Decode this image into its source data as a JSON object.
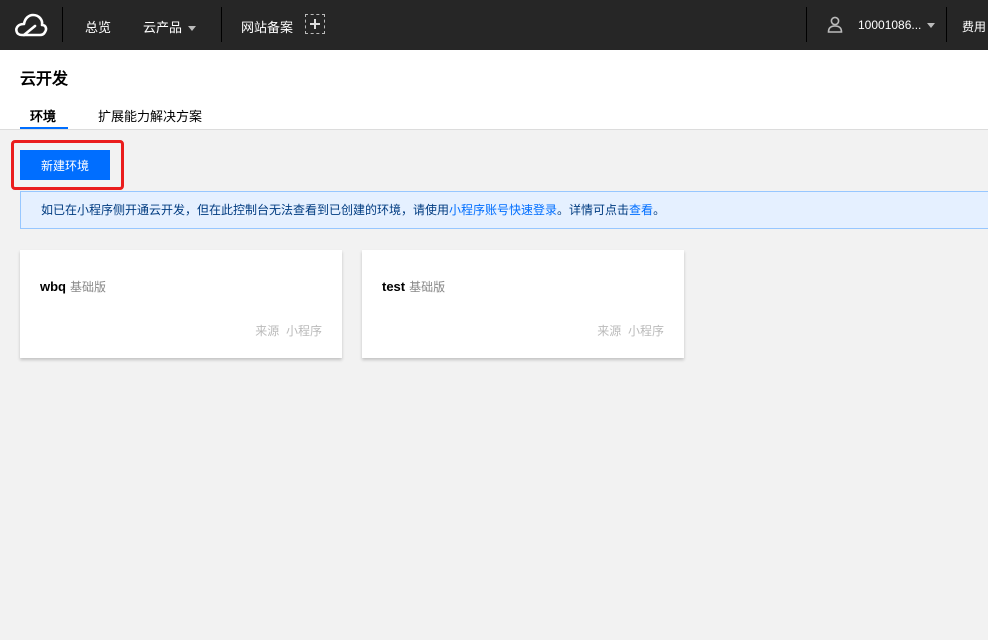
{
  "topbar": {
    "nav": {
      "overview": "总览",
      "products": "云产品",
      "icp": "网站备案"
    },
    "account_id": "10001086...",
    "billing": "费用"
  },
  "page": {
    "title": "云开发",
    "tabs": [
      {
        "label": "环境",
        "active": true
      },
      {
        "label": "扩展能力解决方案",
        "active": false
      }
    ]
  },
  "actions": {
    "new_env_label": "新建环境"
  },
  "notice": {
    "prefix": "如已在小程序侧开通云开发，但在此控制台无法查看到已创建的环境，请使用",
    "link1": "小程序账号快速登录",
    "middle": "。详情可点击",
    "link2": "查看",
    "suffix": "。"
  },
  "environments": [
    {
      "name": "wbq",
      "tag": "基础版",
      "source_label": "来源",
      "source": "小程序"
    },
    {
      "name": "test",
      "tag": "基础版",
      "source_label": "来源",
      "source": "小程序"
    }
  ],
  "colors": {
    "topbar_bg": "#262626",
    "primary": "#006eff",
    "highlight": "#ea1d1d",
    "notice_bg": "#e5f0ff"
  }
}
